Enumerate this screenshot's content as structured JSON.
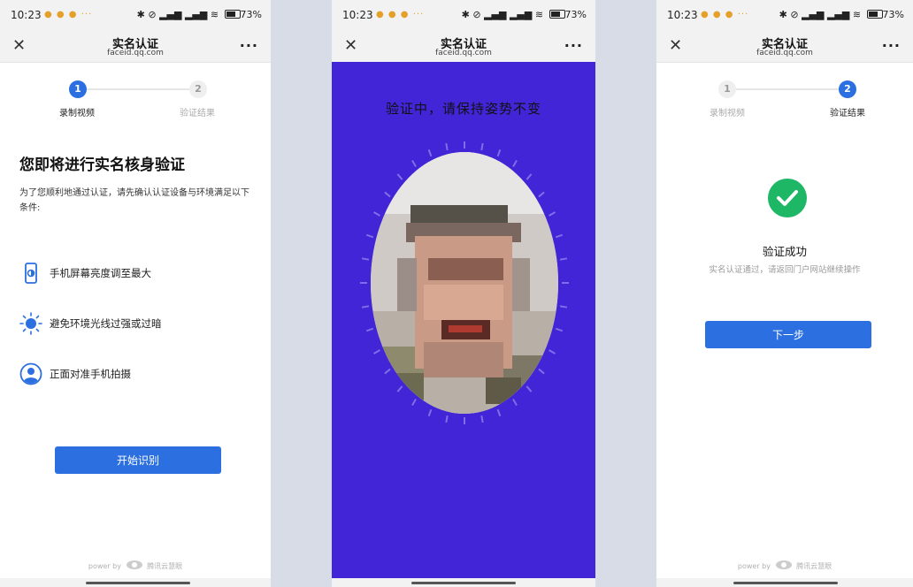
{
  "status_bar": {
    "time": "10:23",
    "app_icons": "● ● ● ···",
    "system_icons": "✱ ⊘ ▂▄▆ ▂▄▆ ≋",
    "battery": "73"
  },
  "nav": {
    "title": "实名认证",
    "subtitle": "faceid.qq.com",
    "close_icon": "close-icon",
    "more_icon": "more-icon"
  },
  "panel1": {
    "steps": [
      {
        "number": "1",
        "label": "录制视频"
      },
      {
        "number": "2",
        "label": "验证结果"
      }
    ],
    "heading": "您即将进行实名核身验证",
    "description": "为了您顺利地通过认证，请先确认认证设备与环境满足以下条件:",
    "conditions": [
      {
        "icon": "phone-brightness-icon",
        "text": "手机屏幕亮度调至最大"
      },
      {
        "icon": "sun-icon",
        "text": "避免环境光线过强或过暗"
      },
      {
        "icon": "person-icon",
        "text": "正面对准手机拍摄"
      }
    ],
    "start_button": "开始识别",
    "footer": {
      "prefix": "power by",
      "brand": "腾讯云慧眼"
    }
  },
  "panel2": {
    "verify_text": "验证中，请保持姿势不变",
    "background_color": "#4125d6"
  },
  "panel3": {
    "steps": [
      {
        "number": "1",
        "label": "录制视频"
      },
      {
        "number": "2",
        "label": "验证结果"
      }
    ],
    "success_title": "验证成功",
    "success_desc": "实名认证通过，请返回门户网站继续操作",
    "next_button": "下一步",
    "footer": {
      "prefix": "power by",
      "brand": "腾讯云慧眼"
    }
  },
  "colors": {
    "primary": "#2b6fe0",
    "success": "#1db765",
    "verify_bg": "#4125d6"
  }
}
